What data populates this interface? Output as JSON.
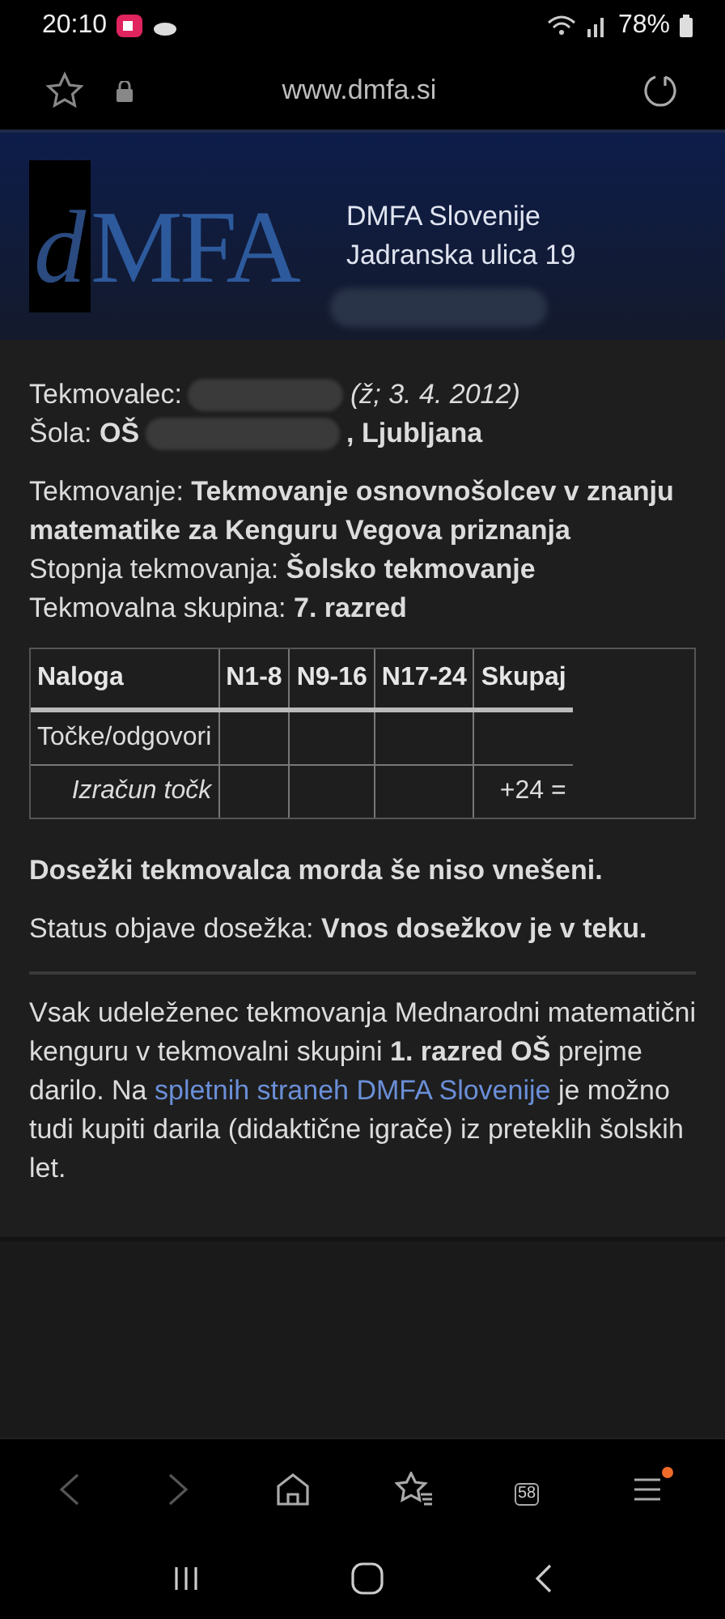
{
  "status_bar": {
    "time": "20:10",
    "battery": "78%"
  },
  "browser": {
    "url": "www.dmfa.si"
  },
  "header": {
    "logo_d": "d",
    "logo_letters": "MFA",
    "lines": [
      "DMFA Slovenije",
      "Jadranska ulica 19"
    ]
  },
  "contestant": {
    "label": "Tekmovalec:",
    "birth": "(ž; 3. 4. 2012)",
    "school_label": "Šola:",
    "school_prefix": "OŠ",
    "school_suffix": ", Ljubljana"
  },
  "details": [
    "Tekmovanje: **Tekmovanje osnovnošolcev v znanju matematike za Kenguru Vegova priznanja**",
    "Stopnja tekmovanja: **Šolsko tekmovanje**",
    "Tekmovalna skupina: **7. razred**"
  ],
  "table": {
    "columns": [
      "Naloga",
      "N1-8",
      "N9-16",
      "N17-24",
      "Skupaj"
    ],
    "rows": [
      {
        "kind": "points",
        "cells": [
          "Točke/odgovori",
          "",
          "",
          "",
          ""
        ]
      },
      {
        "kind": "calc",
        "cells": [
          "Izračun točk",
          "",
          "",
          "",
          "+24 ="
        ]
      }
    ]
  },
  "notice": "Dosežki tekmovalca morda še niso vnešeni.",
  "status": "Status objave dosežka: **Vnos dosežkov je v teku.**",
  "info": {
    "before": "Vsak udeleženec tekmovanja Mednarodni matematični kenguru v tekmovalni skupini **1. razred OŠ** prejme darilo. Na ",
    "link": "spletnih straneh DMFA Slovenije",
    "after": " je možno tudi kupiti darila (didaktične igrače) iz preteklih šolskih let."
  },
  "bottom_nav": {
    "tabs_count": "58",
    "menu_badge": true
  }
}
